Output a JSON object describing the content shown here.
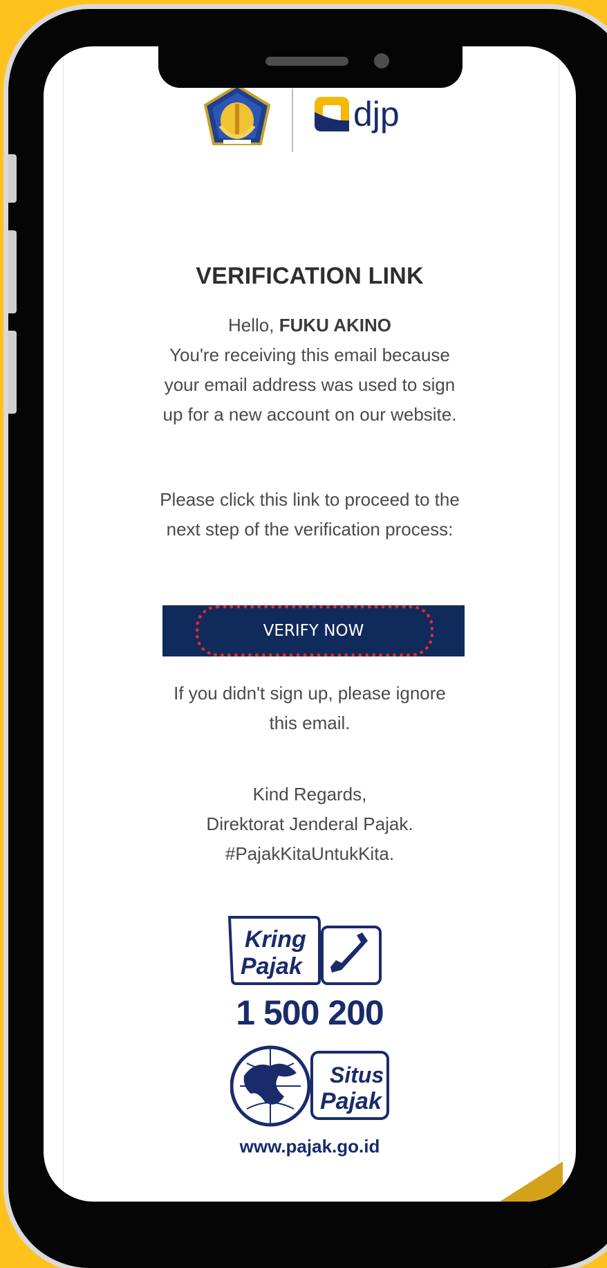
{
  "logos": {
    "agency_text": "djp"
  },
  "email": {
    "title": "VERIFICATION LINK",
    "greeting_prefix": "Hello, ",
    "recipient_name": "FUKU AKINO",
    "intro": "You're receiving this email because your email address was used to sign up for a new account on our website.",
    "instruction": "Please click this link to proceed to the next step of the verification process:",
    "verify_button": "VERIFY NOW",
    "ignore_note": "If you didn't sign up, please ignore this email.",
    "closing": "Kind Regards,",
    "sender": "Direktorat Jenderal Pajak.",
    "hashtag": "#PajakKitaUntukKita."
  },
  "footer": {
    "kring_line1": "Kring",
    "kring_line2": "Pajak",
    "phone": "1 500 200",
    "situs_line1": "Situs",
    "situs_line2": "Pajak",
    "website": "www.pajak.go.id"
  },
  "colors": {
    "background": "#FFC21C",
    "button": "#102A5C",
    "brand_navy": "#1A2B6B",
    "highlight": "#E02B2B"
  }
}
